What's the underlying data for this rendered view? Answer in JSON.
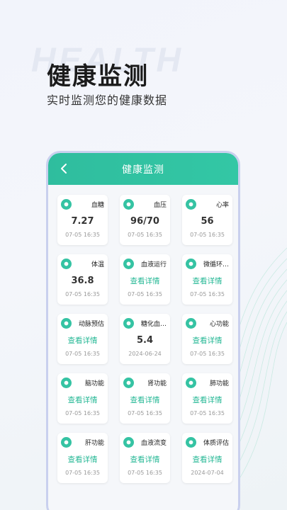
{
  "promo": {
    "bg_word": "HEALTH",
    "headline": "健康监测",
    "subline": "实时监测您的健康数据"
  },
  "header": {
    "title": "健康监测"
  },
  "cards": [
    {
      "name": "血糖",
      "value": "7.27",
      "date": "07-05 16:35",
      "icon": "drop-icon",
      "kind": "value"
    },
    {
      "name": "血压",
      "value": "96/70",
      "date": "07-05 16:35",
      "icon": "pressure-icon",
      "kind": "value"
    },
    {
      "name": "心率",
      "value": "56",
      "date": "07-05 16:35",
      "icon": "heart-icon",
      "kind": "value"
    },
    {
      "name": "体温",
      "value": "36.8",
      "date": "07-05 16:35",
      "icon": "thermometer-icon",
      "kind": "value"
    },
    {
      "name": "血液运行",
      "value": "查看详情",
      "date": "07-05 16:35",
      "icon": "flow-icon",
      "kind": "link"
    },
    {
      "name": "微循环…",
      "value": "查看详情",
      "date": "07-05 16:35",
      "icon": "circulation-icon",
      "kind": "link"
    },
    {
      "name": "动脉预估",
      "value": "查看详情",
      "date": "07-05 16:35",
      "icon": "artery-icon",
      "kind": "link"
    },
    {
      "name": "糖化血…",
      "value": "5.4",
      "date": "2024-06-24",
      "icon": "molecule-icon",
      "kind": "value"
    },
    {
      "name": "心功能",
      "value": "查看详情",
      "date": "07-05 16:35",
      "icon": "heart-organ-icon",
      "kind": "link"
    },
    {
      "name": "脑功能",
      "value": "查看详情",
      "date": "07-05 16:35",
      "icon": "brain-icon",
      "kind": "link"
    },
    {
      "name": "肾功能",
      "value": "查看详情",
      "date": "07-05 16:35",
      "icon": "kidney-icon",
      "kind": "link"
    },
    {
      "name": "肺功能",
      "value": "查看详情",
      "date": "07-05 16:35",
      "icon": "lung-icon",
      "kind": "link"
    },
    {
      "name": "肝功能",
      "value": "查看详情",
      "date": "07-05 16:35",
      "icon": "liver-icon",
      "kind": "link"
    },
    {
      "name": "血液流变",
      "value": "查看详情",
      "date": "07-05 16:35",
      "icon": "blood-flow-icon",
      "kind": "link"
    },
    {
      "name": "体质评估",
      "value": "查看详情",
      "date": "2024-07-04",
      "icon": "tree-icon",
      "kind": "link"
    }
  ],
  "colors": {
    "accent": "#33c7a5",
    "link": "#27b896",
    "frame": "#c9d0ee"
  }
}
